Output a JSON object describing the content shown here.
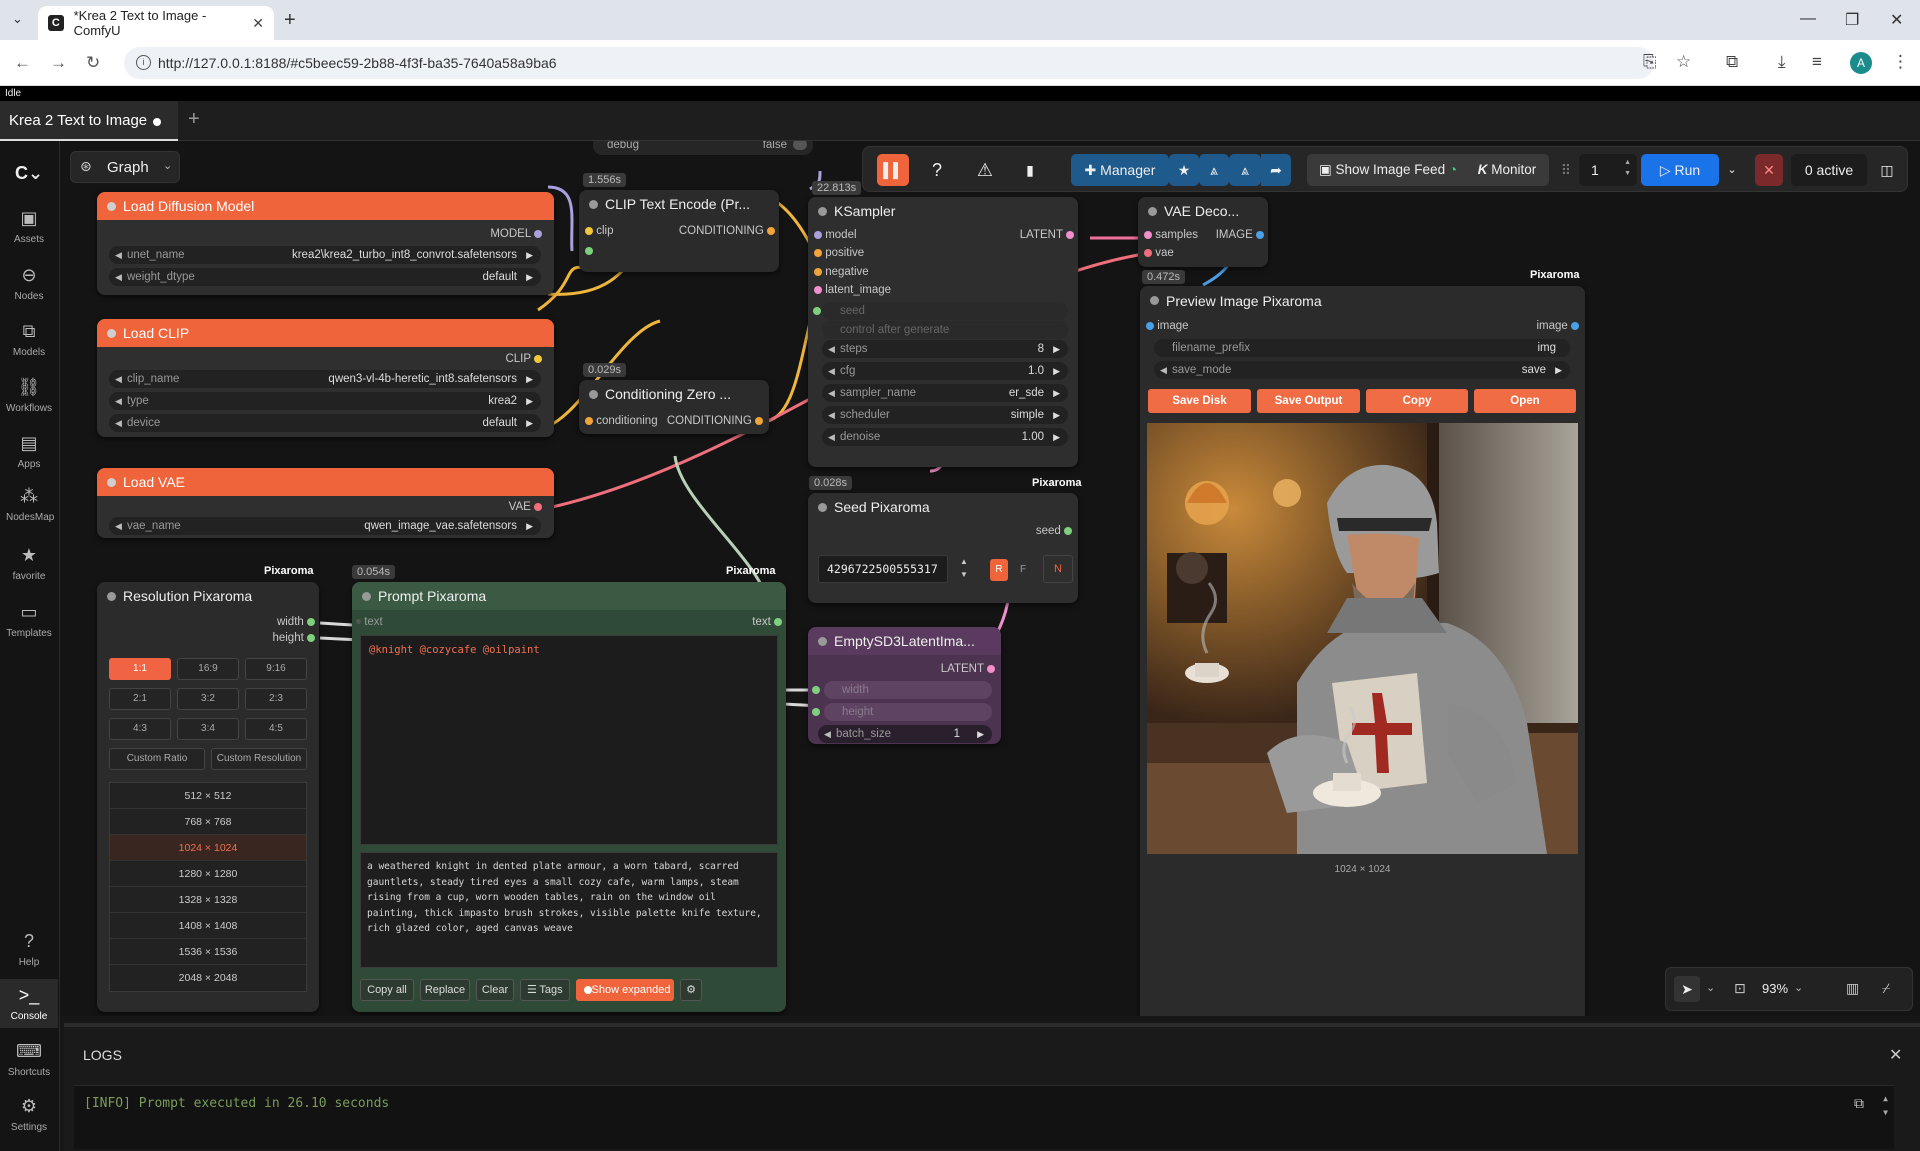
{
  "browser": {
    "tab_title": "*Krea 2 Text to Image - ComfyU",
    "url": "http://127.0.0.1:8188/#c5beec59-2b88-4f3f-ba35-7640a58a9ba6",
    "avatar_letter": "A"
  },
  "app": {
    "status": "Idle",
    "workflow_tab": "Krea 2 Text to Image",
    "graph_label": "Graph"
  },
  "sidebar": {
    "items": [
      {
        "label": "Assets",
        "icon": "assets-icon"
      },
      {
        "label": "Nodes",
        "icon": "nodes-icon"
      },
      {
        "label": "Models",
        "icon": "models-icon"
      },
      {
        "label": "Workflows",
        "icon": "workflows-icon"
      },
      {
        "label": "Apps",
        "icon": "apps-icon"
      },
      {
        "label": "NodesMap",
        "icon": "nodesmap-icon"
      },
      {
        "label": "favorite",
        "icon": "star-icon"
      },
      {
        "label": "Templates",
        "icon": "templates-icon"
      }
    ],
    "bottom": [
      {
        "label": "Help",
        "icon": "help-icon"
      },
      {
        "label": "Console",
        "icon": "console-icon"
      },
      {
        "label": "Shortcuts",
        "icon": "keyboard-icon"
      },
      {
        "label": "Settings",
        "icon": "gear-icon"
      }
    ]
  },
  "toolbar": {
    "manager": "Manager",
    "image_feed": "Show Image Feed",
    "monitor": "Monitor",
    "batch_count": "1",
    "run": "Run",
    "active": "0 active"
  },
  "nodes": {
    "debug_widget": {
      "label": "debug",
      "value": "false"
    },
    "load_diffusion": {
      "title": "Load Diffusion Model",
      "output": "MODEL",
      "unet_name_label": "unet_name",
      "unet_name": "krea2\\krea2_turbo_int8_convrot.safetensors",
      "weight_dtype_label": "weight_dtype",
      "weight_dtype": "default"
    },
    "load_clip": {
      "title": "Load CLIP",
      "output": "CLIP",
      "clip_name_label": "clip_name",
      "clip_name": "qwen3-vl-4b-heretic_int8.safetensors",
      "type_label": "type",
      "type": "krea2",
      "device_label": "device",
      "device": "default"
    },
    "load_vae": {
      "title": "Load VAE",
      "output": "VAE",
      "vae_name_label": "vae_name",
      "vae_name": "qwen_image_vae.safetensors"
    },
    "clip_encode": {
      "title": "CLIP Text Encode (Pr...",
      "time": "1.556s",
      "input": "clip",
      "output": "CONDITIONING"
    },
    "cond_zero": {
      "title": "Conditioning Zero ...",
      "time": "0.029s",
      "input": "conditioning",
      "output": "CONDITIONING"
    },
    "ksampler": {
      "title": "KSampler",
      "time": "22.813s",
      "output": "LATENT",
      "inputs": [
        "model",
        "positive",
        "negative",
        "latent_image"
      ],
      "seed_label": "seed",
      "control_label": "control after generate",
      "steps_label": "steps",
      "steps": "8",
      "cfg_label": "cfg",
      "cfg": "1.0",
      "sampler_label": "sampler_name",
      "sampler": "er_sde",
      "scheduler_label": "scheduler",
      "scheduler": "simple",
      "denoise_label": "denoise",
      "denoise": "1.00"
    },
    "vae_decode": {
      "title": "VAE Deco...",
      "time": "0.472s",
      "in1": "samples",
      "in2": "vae",
      "output": "IMAGE"
    },
    "preview": {
      "badge": "Pixaroma",
      "title": "Preview Image Pixaroma",
      "input": "image",
      "output": "image",
      "prefix_label": "filename_prefix",
      "prefix": "img",
      "save_mode_label": "save_mode",
      "save_mode": "save",
      "buttons": [
        "Save Disk",
        "Save Output",
        "Copy",
        "Open"
      ],
      "dims": "1024 × 1024"
    },
    "seed": {
      "title": "Seed Pixaroma",
      "badge": "Pixaroma",
      "time": "0.028s",
      "output": "seed",
      "value": "4296722500555317",
      "r": "R",
      "f": "F",
      "n": "N"
    },
    "latent": {
      "title": "EmptySD3LatentIma...",
      "output": "LATENT",
      "width_label": "width",
      "height_label": "height",
      "batch_label": "batch_size",
      "batch": "1"
    },
    "resolution": {
      "title": "Resolution Pixaroma",
      "badge": "Pixaroma",
      "out1": "width",
      "out2": "height",
      "ratios": [
        "1:1",
        "16:9",
        "9:16",
        "2:1",
        "3:2",
        "2:3",
        "4:3",
        "3:4",
        "4:5"
      ],
      "custom_ratio": "Custom Ratio",
      "custom_res": "Custom Resolution",
      "sizes": [
        "512 × 512",
        "768 × 768",
        "1024 × 1024",
        "1280 × 1280",
        "1328 × 1328",
        "1408 × 1408",
        "1536 × 1536",
        "2048 × 2048"
      ]
    },
    "prompt": {
      "title": "Prompt Pixaroma",
      "badge": "Pixaroma",
      "time": "0.054s",
      "input": "text",
      "output": "text",
      "tags": "@knight @cozycafe @oilpaint",
      "expanded": "a weathered knight in dented plate armour, a worn tabard, scarred gauntlets, steady tired eyes a small cozy cafe, warm lamps, steam rising from a cup, worn wooden tables, rain on the window oil painting, thick impasto brush strokes, visible palette knife texture, rich glazed color, aged canvas weave",
      "buttons": [
        "Copy all",
        "Replace",
        "Clear",
        "Tags",
        "Show expanded"
      ]
    }
  },
  "zoom": {
    "level": "93%"
  },
  "logs": {
    "title": "LOGS",
    "line": "[INFO] Prompt executed in 26.10 seconds"
  },
  "colors": {
    "accent_orange": "#f0643c",
    "run_blue": "#1a73e8",
    "prompt_green": "#3b5a43",
    "latent_purple": "#5a3a5e"
  }
}
